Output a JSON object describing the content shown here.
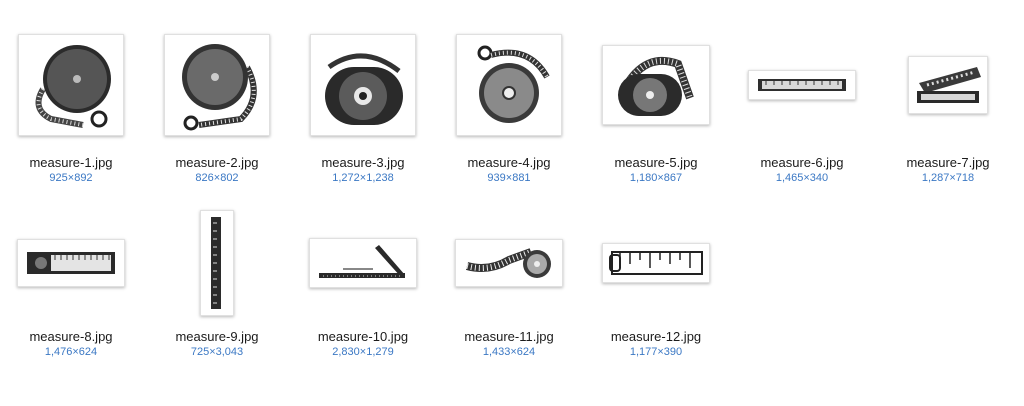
{
  "files": [
    {
      "name": "measure-1.jpg",
      "dims": "925×892",
      "icon": "round-tape-measure-icon"
    },
    {
      "name": "measure-2.jpg",
      "dims": "826×802",
      "icon": "round-tape-measure-icon"
    },
    {
      "name": "measure-3.jpg",
      "dims": "1,272×1,238",
      "icon": "reel-tape-measure-icon"
    },
    {
      "name": "measure-4.jpg",
      "dims": "939×881",
      "icon": "round-tape-measure-icon"
    },
    {
      "name": "measure-5.jpg",
      "dims": "1,180×867",
      "icon": "reel-tape-measure-icon"
    },
    {
      "name": "measure-6.jpg",
      "dims": "1,465×340",
      "icon": "folding-ruler-icon"
    },
    {
      "name": "measure-7.jpg",
      "dims": "1,287×718",
      "icon": "folding-ruler-icon"
    },
    {
      "name": "measure-8.jpg",
      "dims": "1,476×624",
      "icon": "folding-ruler-icon"
    },
    {
      "name": "measure-9.jpg",
      "dims": "725×3,043",
      "icon": "vertical-ruler-icon"
    },
    {
      "name": "measure-10.jpg",
      "dims": "2,830×1,279",
      "icon": "carpenter-square-icon"
    },
    {
      "name": "measure-11.jpg",
      "dims": "1,433×624",
      "icon": "tape-roll-icon"
    },
    {
      "name": "measure-12.jpg",
      "dims": "1,177×390",
      "icon": "tape-closeup-icon"
    }
  ]
}
